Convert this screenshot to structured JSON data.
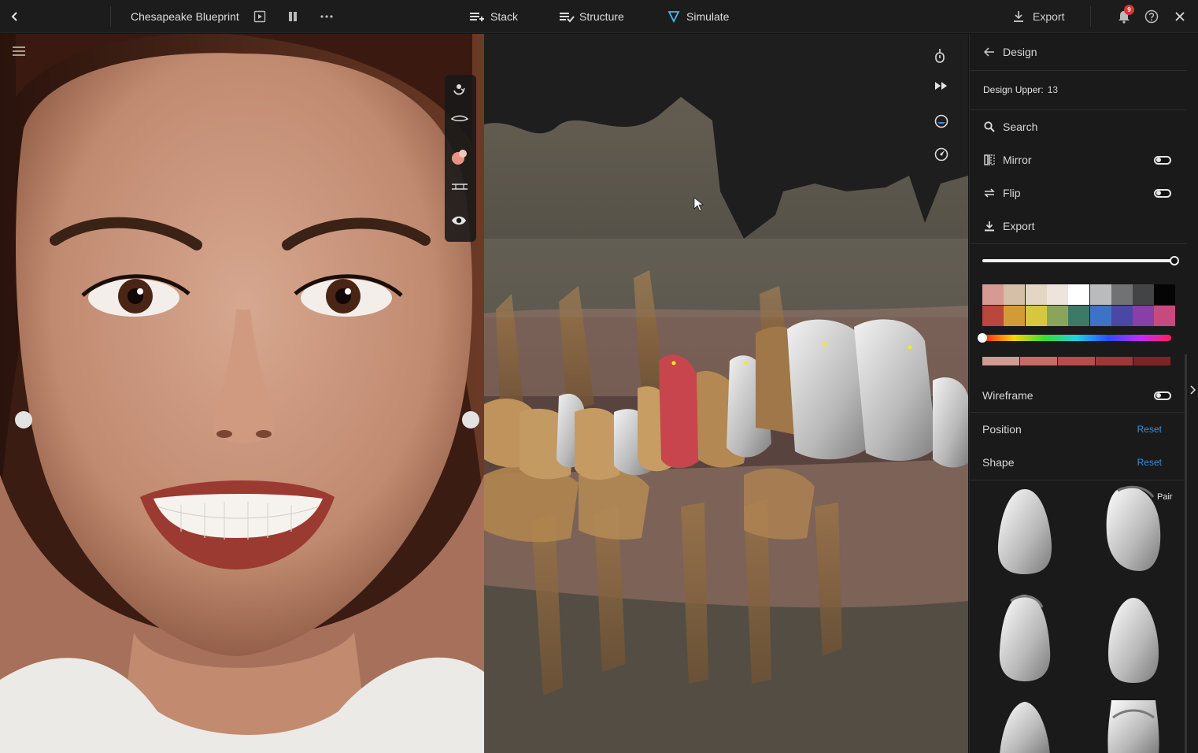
{
  "topbar": {
    "title": "Chesapeake Blueprint",
    "nav": {
      "stack": "Stack",
      "structure": "Structure",
      "simulate": "Simulate"
    },
    "export": "Export",
    "notification_count": "9",
    "icons": [
      "back-chevron-icon",
      "play-icon",
      "columns-icon",
      "more-icon",
      "stack-icon",
      "structure-icon",
      "simulate-icon",
      "download-icon",
      "bell-icon",
      "help-icon",
      "close-icon"
    ]
  },
  "photo_tools": [
    "rotate-face-icon",
    "lip-line-icon",
    "color-tone-icon",
    "midline-icon",
    "eye-icon"
  ],
  "viewport_tools": [
    "lock-icon",
    "fast-forward-icon",
    "view-mode-icon",
    "compass-icon"
  ],
  "panel": {
    "header": "Design",
    "design_upper_label": "Design Upper:",
    "design_upper_value": "13",
    "search": "Search",
    "mirror": "Mirror",
    "flip": "Flip",
    "export": "Export",
    "opacity_value": 1.0,
    "swatches_row1": [
      "#d69a93",
      "#d5bfa6",
      "#e4d6c2",
      "#ede5dc",
      "#ffffff",
      "#b9bbbc",
      "#707274",
      "#424446",
      "#050505"
    ],
    "swatches_row2": [
      "#b9473c",
      "#d39a37",
      "#d6c73e",
      "#8aa55a",
      "#3b7a66",
      "#3d73c6",
      "#4b47a7",
      "#8a3ea9",
      "#c64a80"
    ],
    "shade_row": [
      "#d19a93",
      "#c96a69",
      "#b84b4d",
      "#a03639",
      "#7f2426"
    ],
    "wireframe": "Wireframe",
    "position": "Position",
    "shape": "Shape",
    "reset": "Reset",
    "pair": "Pair"
  }
}
